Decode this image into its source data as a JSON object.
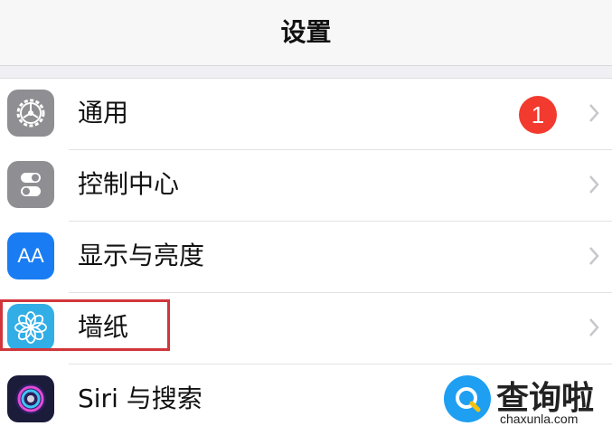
{
  "navbar": {
    "title": "设置"
  },
  "rows": [
    {
      "label": "通用",
      "icon": "gear-icon",
      "icon_color": "#8e8e93",
      "badge": "1"
    },
    {
      "label": "控制中心",
      "icon": "control-center-icon",
      "icon_color": "#8e8e93"
    },
    {
      "label": "显示与亮度",
      "icon": "display-brightness-icon",
      "icon_color": "#1a7cf3",
      "icon_text": "AA"
    },
    {
      "label": "墙纸",
      "icon": "wallpaper-flower-icon",
      "icon_color": "#32aee6"
    },
    {
      "label": "Siri 与搜索",
      "icon": "siri-icon",
      "icon_color": "#1b1b3a"
    }
  ],
  "colors": {
    "badge": "#f23a2f",
    "highlight_border": "#d0363c",
    "chevron": "#c7c7cc"
  },
  "watermark": {
    "text": "查询啦",
    "subtext": "chaxunla.com"
  }
}
